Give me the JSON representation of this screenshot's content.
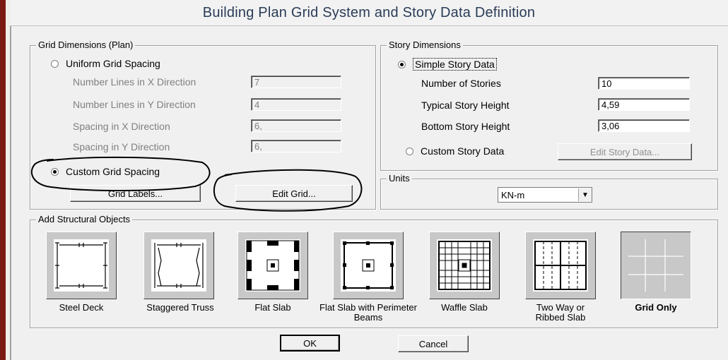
{
  "window": {
    "title": "Building Plan Grid System and Story Data Definition"
  },
  "grid_dimensions": {
    "legend": "Grid Dimensions (Plan)",
    "uniform_label": "Uniform Grid Spacing",
    "uniform_selected": false,
    "fields": [
      {
        "label": "Number Lines in X Direction",
        "value": "7"
      },
      {
        "label": "Number Lines in Y Direction",
        "value": "4"
      },
      {
        "label": "Spacing in X Direction",
        "value": "6,"
      },
      {
        "label": "Spacing in Y Direction",
        "value": "6,"
      }
    ],
    "custom_label": "Custom Grid Spacing",
    "custom_selected": true,
    "grid_labels_button": "Grid Labels...",
    "edit_grid_button": "Edit Grid..."
  },
  "story_dimensions": {
    "legend": "Story Dimensions",
    "simple_label": "Simple Story Data",
    "simple_selected": true,
    "fields": [
      {
        "label": "Number of Stories",
        "value": "10"
      },
      {
        "label": "Typical Story Height",
        "value": "4,59"
      },
      {
        "label": "Bottom Story Height",
        "value": "3,06"
      }
    ],
    "custom_label": "Custom Story Data",
    "custom_selected": false,
    "edit_story_button": "Edit Story Data..."
  },
  "units": {
    "legend": "Units",
    "selected": "KN-m"
  },
  "structural_objects": {
    "legend": "Add Structural Objects",
    "items": [
      {
        "label": "Steel Deck",
        "icon": "steel-deck-icon"
      },
      {
        "label": "Staggered Truss",
        "icon": "staggered-truss-icon"
      },
      {
        "label": "Flat Slab",
        "icon": "flat-slab-icon"
      },
      {
        "label": "Flat Slab with Perimeter Beams",
        "icon": "flat-slab-perimeter-beams-icon"
      },
      {
        "label": "Waffle Slab",
        "icon": "waffle-slab-icon"
      },
      {
        "label": "Two Way or Ribbed Slab",
        "icon": "two-way-ribbed-slab-icon"
      },
      {
        "label": "Grid Only",
        "icon": "grid-only-icon",
        "selected": true
      }
    ]
  },
  "footer": {
    "ok": "OK",
    "cancel": "Cancel"
  },
  "colors": {
    "title_text": "#2a3c57",
    "dialog_bg": "#f0f0f0",
    "annotation": "#000000"
  }
}
